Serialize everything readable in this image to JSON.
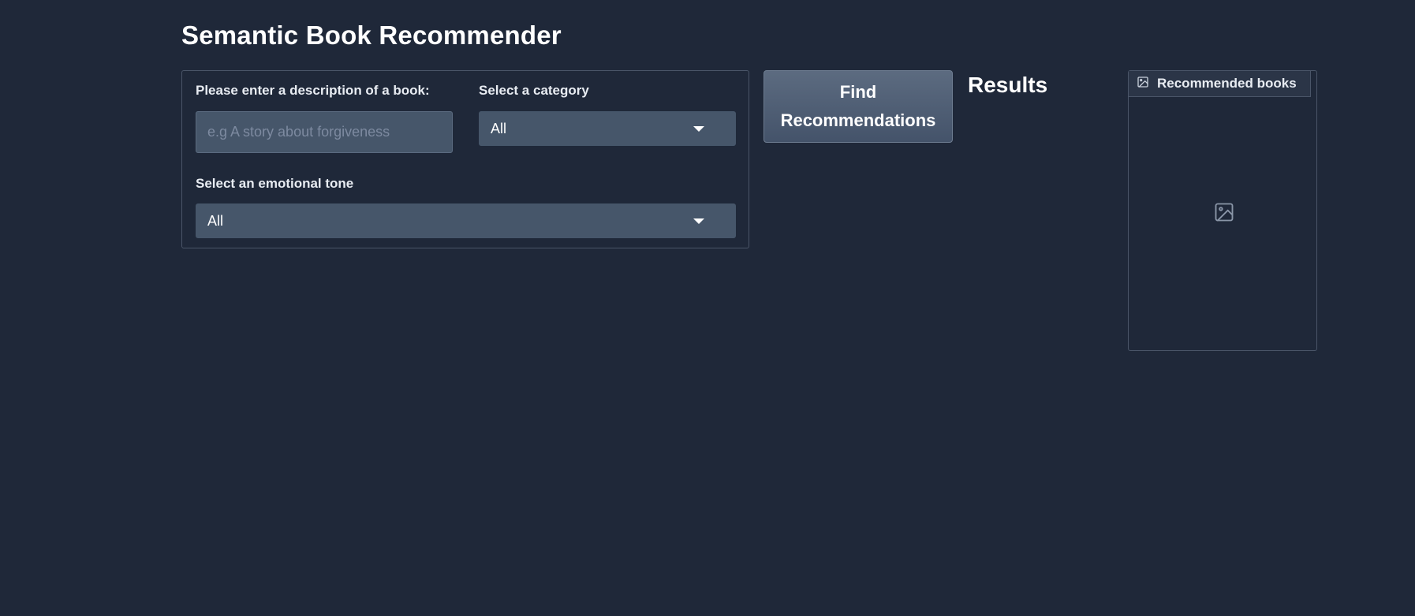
{
  "app": {
    "title": "Semantic Book Recommender"
  },
  "form": {
    "description": {
      "label": "Please enter a description of a book:",
      "placeholder": "e.g A story about forgiveness",
      "value": ""
    },
    "category": {
      "label": "Select a category",
      "selected": "All"
    },
    "tone": {
      "label": "Select an emotional tone",
      "selected": "All"
    }
  },
  "actions": {
    "submit_label": "Find Recommendations"
  },
  "results": {
    "heading": "Results",
    "gallery_label": "Recommended books",
    "gallery_icon": "image-icon"
  },
  "colors": {
    "background": "#1f2839",
    "input_bg": "#46566a",
    "border": "#4a5568",
    "button_bg": "#4f5e74",
    "text": "#ffffff",
    "placeholder": "#7d8aa0"
  }
}
